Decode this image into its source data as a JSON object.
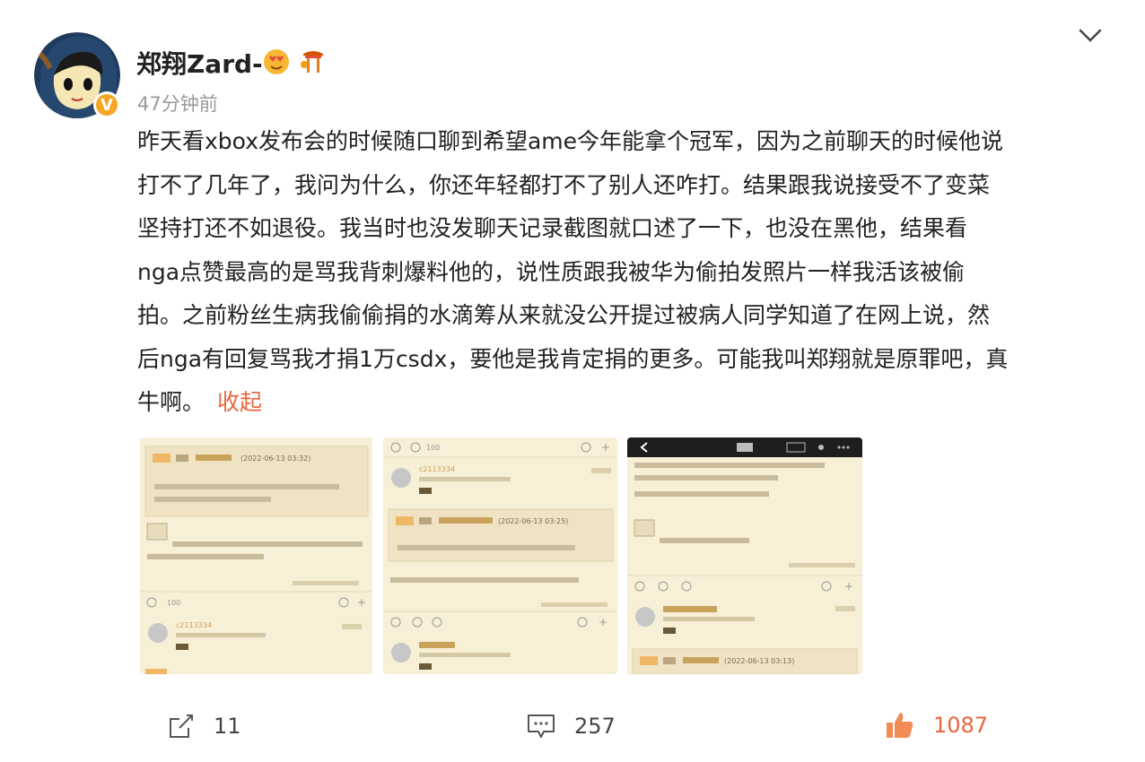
{
  "post": {
    "author": "郑翔Zard-",
    "timestamp": "47分钟前",
    "lines": [
      "昨天看xbox发布会的时候随口聊到希望ame今年能拿个冠军，因为之前聊天的时候他说",
      "打不了几年了，我问为什么，你还年轻都打不了别人还咋打。结果跟我说接受不了变菜",
      "坚持打还不如退役。我当时也没发聊天记录截图就口述了一下，也没在黑他，结果看",
      "nga点赞最高的是骂我背刺爆料他的，说性质跟我被华为偷拍发照片一样我活该被偷",
      "拍。之前粉丝生病我偷偷捐的水滴筹从来就没公开提过被病人同学知道了在网上说，然",
      "后nga有回复骂我才捐1万csdx，要他是我肯定捐的更多。可能我叫郑翔就是原罪吧，真",
      "牛啊。"
    ],
    "collapse_label": "收起"
  },
  "images": {
    "img1": {
      "date": "(2022-06-13 03:32)",
      "user": "c2113334"
    },
    "img2": {
      "top_count": "100",
      "user": "c2113334",
      "date": "(2022-06-13 03:25)"
    },
    "img3": {
      "date": "(2022-06-13 03:13)"
    }
  },
  "actions": {
    "share_count": "11",
    "comment_count": "257",
    "like_count": "1087"
  },
  "colors": {
    "accent": "#e8663e",
    "muted": "#999999",
    "image_bg": "#f7efd6"
  },
  "icons": [
    "chevron-down-icon",
    "share-icon",
    "comment-icon",
    "like-icon",
    "verified-icon"
  ]
}
